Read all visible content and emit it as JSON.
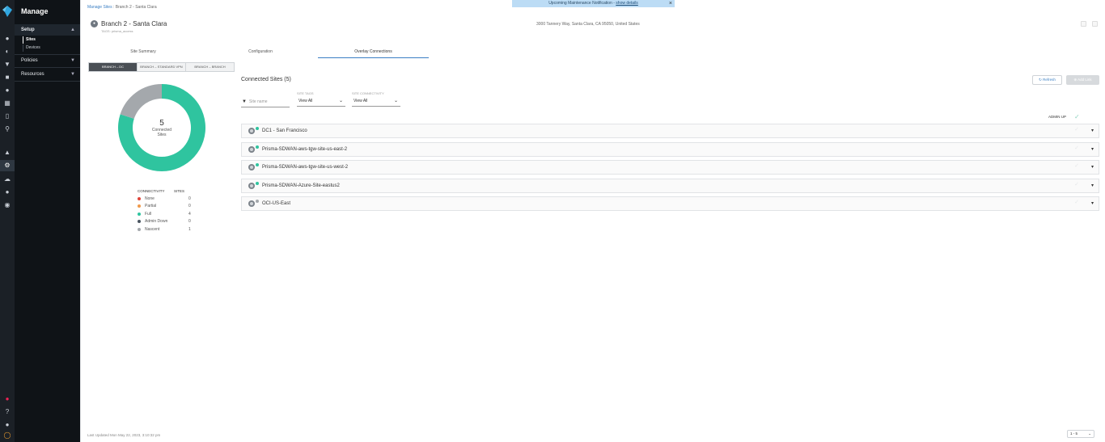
{
  "nav": {
    "title": "Manage",
    "sections": [
      {
        "label": "Setup",
        "open": true,
        "items": [
          "Sites",
          "Devices"
        ],
        "active": "Sites"
      },
      {
        "label": "Policies",
        "open": false
      },
      {
        "label": "Resources",
        "open": false
      }
    ]
  },
  "breadcrumb": {
    "parent": "Manage Sites",
    "current": "Branch 2 - Santa Clara"
  },
  "banner": {
    "text": "Upcoming Maintenance Notification - ",
    "link": "show details",
    "close": "×"
  },
  "site": {
    "title": "Branch 2 - Santa Clara",
    "tags": "TAGS: prisma_access",
    "address": "3000 Tannery Way, Santa Clara, CA 95050, United States"
  },
  "tabs": [
    "Site Summary",
    "Configuration",
    "Overlay Connections"
  ],
  "active_tab": "Overlay Connections",
  "segments": [
    "BRANCH – DC",
    "BRANCH – STANDARD VPN",
    "BRANCH – BRANCH"
  ],
  "active_segment": "BRANCH – DC",
  "donut": {
    "count": "5",
    "label_line1": "Connected",
    "label_line2": "Sites"
  },
  "legend": {
    "header_connectivity": "CONNECTIVITY",
    "header_sites": "SITES",
    "rows": [
      {
        "label": "None",
        "value": "0",
        "color": "#e0453a"
      },
      {
        "label": "Partial",
        "value": "0",
        "color": "#f0994a"
      },
      {
        "label": "Full",
        "value": "4",
        "color": "#2fc49f"
      },
      {
        "label": "Admin Down",
        "value": "0",
        "color": "#4a5560"
      },
      {
        "label": "Nascent",
        "value": "1",
        "color": "#a4a8ac"
      }
    ]
  },
  "chart_data": {
    "type": "pie",
    "categories": [
      "None",
      "Partial",
      "Full",
      "Admin Down",
      "Nascent"
    ],
    "values": [
      0,
      0,
      4,
      0,
      1
    ],
    "colors": [
      "#e0453a",
      "#f0994a",
      "#2fc49f",
      "#4a5560",
      "#a4a8ac"
    ],
    "title": ""
  },
  "connected": {
    "title": "Connected Sites (5)",
    "refresh": "Refresh",
    "add_link": "Add Link"
  },
  "filters": {
    "site_name_placeholder": "Site name",
    "site_tags_label": "SITE TAGS",
    "site_tags_value": "View All",
    "site_conn_label": "SITE CONNECTIVITY",
    "site_conn_value": "View All"
  },
  "admin_up": "ADMIN UP",
  "sites": [
    {
      "name": "DC1 - San Francisco",
      "status_color": "#2fc49f"
    },
    {
      "name": "Prisma-SDWAN-aws-tgw-site-us-east-2",
      "status_color": "#2fc49f"
    },
    {
      "name": "Prisma-SDWAN-aws-tgw-site-us-west-2",
      "status_color": "#2fc49f"
    },
    {
      "name": "Prisma-SDWAN-Azure-Site-eastus2",
      "status_color": "#2fc49f"
    },
    {
      "name": "OCI-US-East",
      "status_color": "#a4a8ac"
    }
  ],
  "footer": "Last Updated Mon May 22, 2023, 3:10:32 pm",
  "pager": "1 - 5"
}
